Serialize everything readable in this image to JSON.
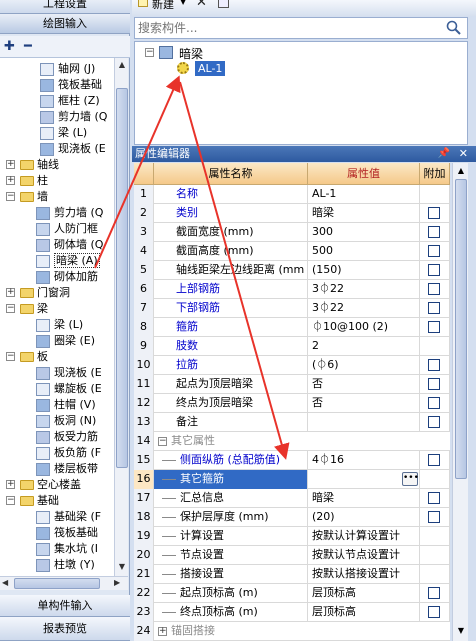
{
  "left_panel": {
    "top_tab": "工程设置",
    "active_tab": "绘图输入",
    "bottom_tabs": [
      "单构件输入",
      "报表预览"
    ],
    "tree": [
      {
        "label": "轴网 (J)",
        "level": 3,
        "icon": "axis-icon"
      },
      {
        "label": "筏板基础",
        "level": 3,
        "icon": "raft-icon"
      },
      {
        "label": "框柱 (Z)",
        "level": 3,
        "icon": "column-icon"
      },
      {
        "label": "剪力墙 (Q",
        "level": 3,
        "icon": "shear-wall-icon"
      },
      {
        "label": "梁 (L)",
        "level": 3,
        "icon": "beam-icon"
      },
      {
        "label": "现浇板 (E",
        "level": 3,
        "icon": "slab-icon"
      },
      {
        "label": "轴线",
        "level": 1,
        "icon": "folder-icon",
        "exp": "+"
      },
      {
        "label": "柱",
        "level": 1,
        "icon": "folder-icon",
        "exp": "+"
      },
      {
        "label": "墙",
        "level": 1,
        "icon": "folder-icon",
        "exp": "−"
      },
      {
        "label": "剪力墙 (Q",
        "level": 2,
        "icon": "shear-wall-icon"
      },
      {
        "label": "人防门框",
        "level": 2,
        "icon": "civil-door-icon"
      },
      {
        "label": "砌体墙 (Q",
        "level": 2,
        "icon": "masonry-wall-icon"
      },
      {
        "label": "暗梁 (A)",
        "level": 2,
        "icon": "hidden-beam-icon",
        "selected": true
      },
      {
        "label": "砌体加筋",
        "level": 2,
        "icon": "masonry-rebar-icon"
      },
      {
        "label": "门窗洞",
        "level": 1,
        "icon": "folder-icon",
        "exp": "+"
      },
      {
        "label": "梁",
        "level": 1,
        "icon": "folder-icon",
        "exp": "−"
      },
      {
        "label": "梁 (L)",
        "level": 2,
        "icon": "beam-icon"
      },
      {
        "label": "圈梁 (E)",
        "level": 2,
        "icon": "ring-beam-icon"
      },
      {
        "label": "板",
        "level": 1,
        "icon": "folder-icon",
        "exp": "−"
      },
      {
        "label": "现浇板 (E",
        "level": 2,
        "icon": "slab-icon"
      },
      {
        "label": "螺旋板 (E",
        "level": 2,
        "icon": "spiral-slab-icon"
      },
      {
        "label": "柱帽 (V)",
        "level": 2,
        "icon": "column-cap-icon"
      },
      {
        "label": "板洞 (N)",
        "level": 2,
        "icon": "slab-hole-icon"
      },
      {
        "label": "板受力筋",
        "level": 2,
        "icon": "slab-rebar-icon"
      },
      {
        "label": "板负筋 (F",
        "level": 2,
        "icon": "slab-neg-rebar-icon"
      },
      {
        "label": "楼层板带",
        "level": 2,
        "icon": "floor-strip-icon"
      },
      {
        "label": "空心楼盖",
        "level": 1,
        "icon": "folder-icon",
        "exp": "+"
      },
      {
        "label": "基础",
        "level": 1,
        "icon": "folder-icon",
        "exp": "−"
      },
      {
        "label": "基础梁 (F",
        "level": 2,
        "icon": "foundation-beam-icon"
      },
      {
        "label": "筏板基础",
        "level": 2,
        "icon": "raft-icon"
      },
      {
        "label": "集水坑 (I",
        "level": 2,
        "icon": "sump-icon"
      },
      {
        "label": "柱墩 (Y)",
        "level": 2,
        "icon": "column-pier-icon"
      }
    ]
  },
  "right_toolbar": {
    "new_label": "新建",
    "delete_icon": "close-icon",
    "copy_icon": "copy-icon"
  },
  "search": {
    "placeholder": "搜索构件..."
  },
  "component_tree": {
    "root": "暗梁",
    "child": "AL-1"
  },
  "property_editor": {
    "title": "属性编辑器",
    "pin_icon": "pin-icon",
    "close_icon": "close-icon",
    "headers": [
      "属性名称",
      "属性值",
      "附加"
    ],
    "rows": [
      {
        "num": "1",
        "name": "名称",
        "value": "AL-1",
        "blue": true,
        "checkbox": false
      },
      {
        "num": "2",
        "name": "类别",
        "value": "暗梁",
        "blue": true,
        "checkbox": true
      },
      {
        "num": "3",
        "name": "截面宽度 (mm)",
        "value": "300",
        "blue": false,
        "checkbox": true
      },
      {
        "num": "4",
        "name": "截面高度 (mm)",
        "value": "500",
        "blue": false,
        "checkbox": true
      },
      {
        "num": "5",
        "name": "轴线距梁左边线距离 (mm",
        "value": "(150)",
        "blue": false,
        "checkbox": true
      },
      {
        "num": "6",
        "name": "上部钢筋",
        "value": "3⏀22",
        "blue": true,
        "checkbox": true
      },
      {
        "num": "7",
        "name": "下部钢筋",
        "value": "3⏀22",
        "blue": true,
        "checkbox": true
      },
      {
        "num": "8",
        "name": "箍筋",
        "value": "⏀10@100 (2)",
        "blue": true,
        "checkbox": true
      },
      {
        "num": "9",
        "name": "肢数",
        "value": "2",
        "blue": true,
        "checkbox": false
      },
      {
        "num": "10",
        "name": "拉筋",
        "value": "(⏀6)",
        "blue": true,
        "checkbox": true
      },
      {
        "num": "11",
        "name": "起点为顶层暗梁",
        "value": "否",
        "blue": false,
        "checkbox": true
      },
      {
        "num": "12",
        "name": "终点为顶层暗梁",
        "value": "否",
        "blue": false,
        "checkbox": true
      },
      {
        "num": "13",
        "name": "备注",
        "value": "",
        "blue": false,
        "checkbox": true
      },
      {
        "num": "14",
        "name": "其它属性",
        "value": "",
        "group": true,
        "exp": "−"
      },
      {
        "num": "15",
        "name": "侧面纵筋 (总配筋值)",
        "value": "4⏀16",
        "blue": true,
        "checkbox": true,
        "indent": true
      },
      {
        "num": "16",
        "name": "其它箍筋",
        "value": "",
        "blue": false,
        "checkbox": false,
        "indent": true,
        "selected": true,
        "ellipsis": true
      },
      {
        "num": "17",
        "name": "汇总信息",
        "value": "暗梁",
        "blue": false,
        "checkbox": true,
        "indent": true
      },
      {
        "num": "18",
        "name": "保护层厚度 (mm)",
        "value": "(20)",
        "blue": false,
        "checkbox": true,
        "indent": true
      },
      {
        "num": "19",
        "name": "计算设置",
        "value": "按默认计算设置计",
        "blue": false,
        "checkbox": false,
        "indent": true
      },
      {
        "num": "20",
        "name": "节点设置",
        "value": "按默认节点设置计",
        "blue": false,
        "checkbox": false,
        "indent": true
      },
      {
        "num": "21",
        "name": "搭接设置",
        "value": "按默认搭接设置计",
        "blue": false,
        "checkbox": false,
        "indent": true
      },
      {
        "num": "22",
        "name": "起点顶标高 (m)",
        "value": "层顶标高",
        "blue": false,
        "checkbox": true,
        "indent": true
      },
      {
        "num": "23",
        "name": "终点顶标高 (m)",
        "value": "层顶标高",
        "blue": false,
        "checkbox": true,
        "indent": true
      },
      {
        "num": "24",
        "name": "锚固搭接",
        "value": "",
        "group": true,
        "exp": "+"
      }
    ]
  },
  "colors": {
    "selection": "#316ac5",
    "header_bg": "#f5c98a",
    "title_bar": "#2e5aa0",
    "annotation_arrow": "#e8332a"
  }
}
